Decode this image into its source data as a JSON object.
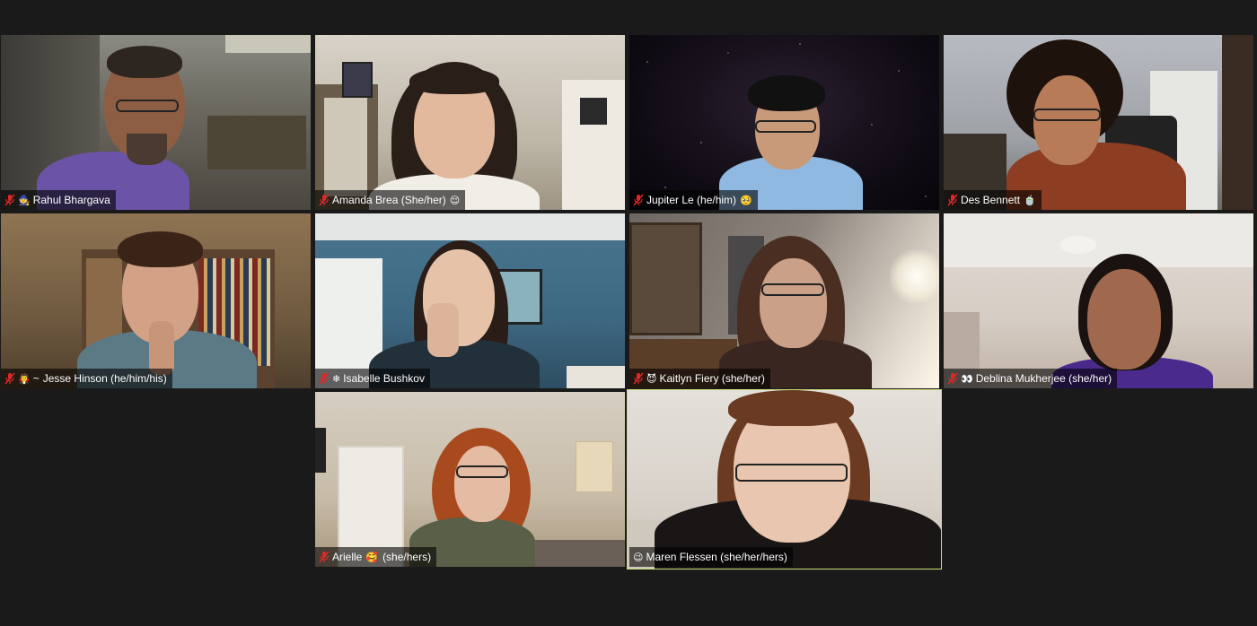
{
  "meeting": {
    "participants": [
      {
        "emoji_before": "🧙",
        "name": "Rahul Bhargava",
        "emoji_after": "",
        "muted": true
      },
      {
        "emoji_before": "",
        "name": "Amanda Brea (She/her)",
        "emoji_after": "😌",
        "muted": true
      },
      {
        "emoji_before": "",
        "name": "Jupiter Le (he/him)",
        "emoji_after": "🥺",
        "muted": true
      },
      {
        "emoji_before": "",
        "name": "Des Bennett",
        "emoji_after": "🍵",
        "muted": true
      },
      {
        "emoji_before": "🧛",
        "prefix": "~",
        "name": "Jesse Hinson (he/him/his)",
        "emoji_after": "",
        "muted": true
      },
      {
        "emoji_before": "❄",
        "name": "Isabelle Bushkov",
        "emoji_after": "",
        "muted": true
      },
      {
        "emoji_before": "😈",
        "name": "Kaitlyn Fiery (she/her)",
        "emoji_after": "",
        "muted": true
      },
      {
        "emoji_before": "👀",
        "name": "Deblina Mukherjee (she/her)",
        "emoji_after": "",
        "muted": true
      },
      {
        "emoji_before": "",
        "name": "Arielle",
        "emoji_after": "🥰",
        "suffix": "(she/hers)",
        "muted": true
      },
      {
        "emoji_before": "😉",
        "name": "Maren Flessen (she/her/hers)",
        "emoji_after": "",
        "muted": false,
        "active_speaker": true
      }
    ]
  },
  "colors": {
    "background": "#1a1a1a",
    "active_speaker_border": "#cfe07a",
    "mute_icon": "#e02828"
  },
  "icons": {
    "mute": "microphone-muted-icon"
  }
}
